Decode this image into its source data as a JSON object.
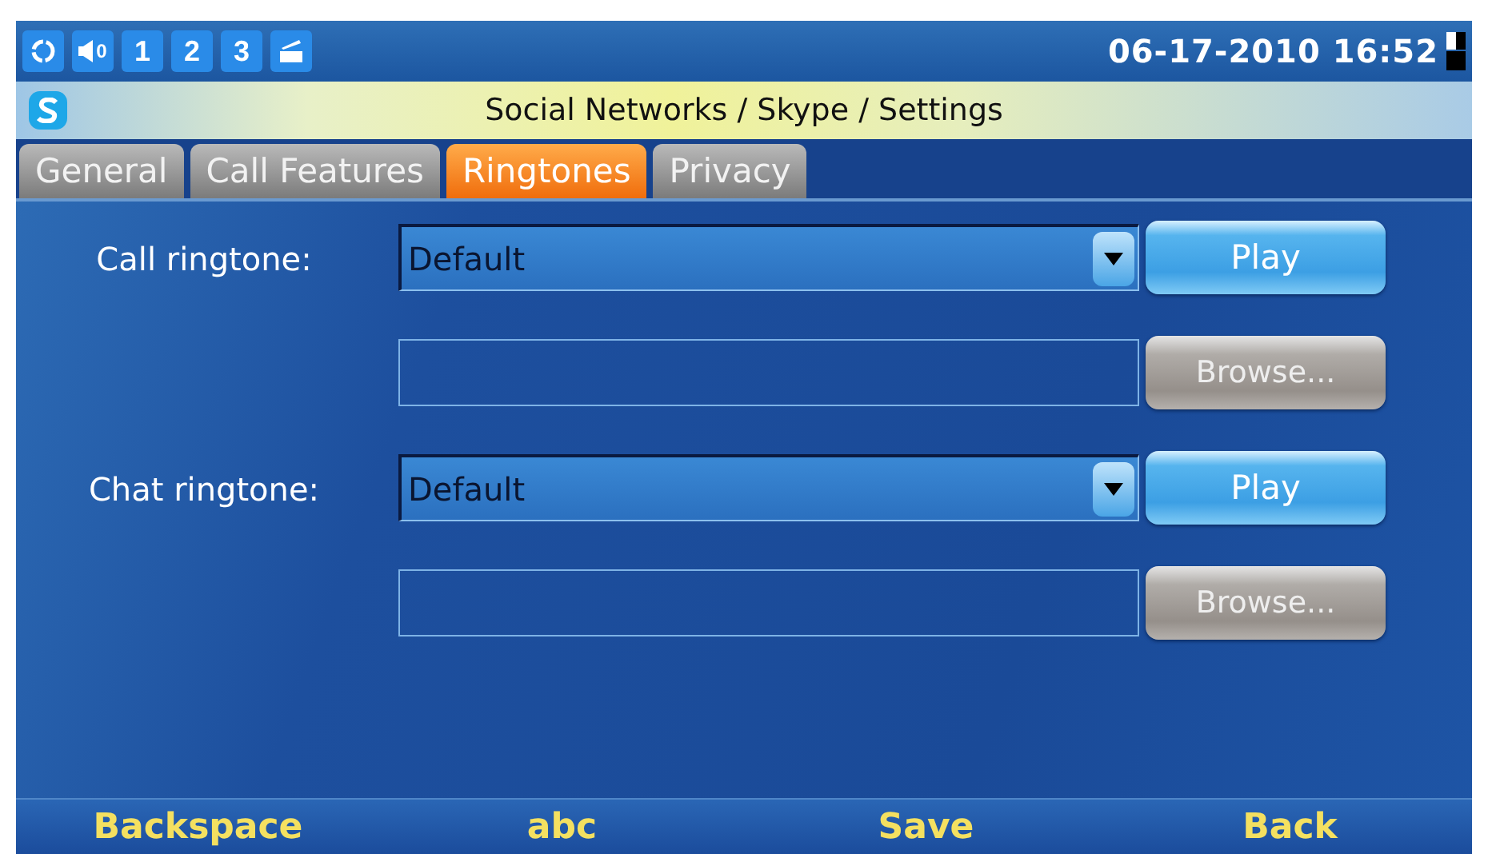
{
  "status_bar": {
    "volume": "0",
    "lines": [
      "1",
      "2",
      "3"
    ],
    "datetime": "06-17-2010 16:52"
  },
  "title_bar": {
    "title": "Social Networks / Skype / Settings"
  },
  "tabs": [
    {
      "label": "General",
      "selected": false
    },
    {
      "label": "Call Features",
      "selected": false
    },
    {
      "label": "Ringtones",
      "selected": true
    },
    {
      "label": "Privacy",
      "selected": false
    }
  ],
  "settings": [
    {
      "label": "Call ringtone:",
      "value": "Default",
      "play": "Play",
      "browse": "Browse...",
      "browse_disabled": true
    },
    {
      "label": "Chat ringtone:",
      "value": "Default",
      "play": "Play",
      "browse": "Browse...",
      "browse_disabled": true
    }
  ],
  "softkeys": [
    "Backspace",
    "abc",
    "Save",
    "Back"
  ]
}
